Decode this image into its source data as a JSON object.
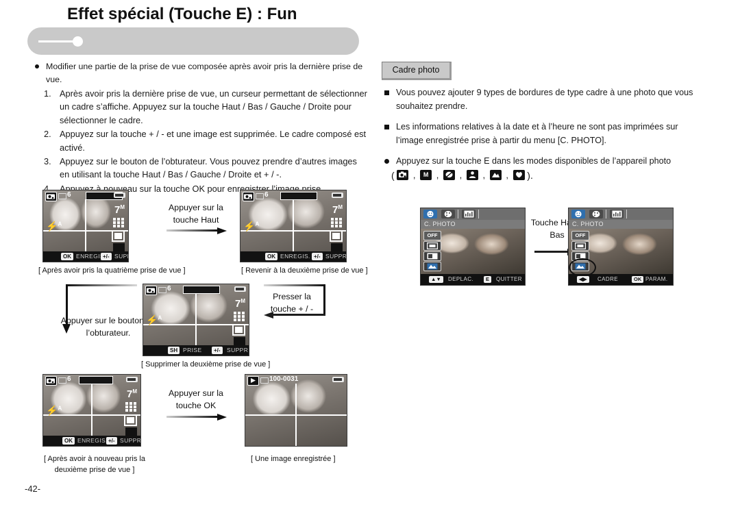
{
  "page": {
    "title": "Effet spécial (Touche E) : Fun",
    "page_number": "-42-"
  },
  "left_column": {
    "intro": "Modifier une partie de la prise de vue composée après avoir pris la dernière prise de vue.",
    "steps": [
      {
        "num": "1.",
        "text": "Après avoir pris la dernière prise de vue, un curseur permettant de sélectionner un cadre s’affiche. Appuyez sur la touche Haut / Bas / Gauche / Droite pour sélectionner le cadre."
      },
      {
        "num": "2.",
        "text": "Appuyez sur la touche + / - et une image est supprimée. Le cadre composé est activé."
      },
      {
        "num": "3.",
        "text": "Appuyez sur le bouton de l’obturateur. Vous pouvez prendre d’autres images en utilisant la touche Haut / Bas / Gauche / Droite et + / -."
      },
      {
        "num": "4.",
        "text": "Appuyez à nouveau sur la touche OK pour enregistrer l’image prise."
      }
    ]
  },
  "right_column": {
    "tab_label": "Cadre photo",
    "notes": [
      "Vous pouvez ajouter 9 types de bordures de type cadre à une photo que vous souhaitez prendre.",
      "Les informations relatives à la date et à l’heure ne sont pas imprimées sur l’image enregistrée prise à partir du menu [C. PHOTO]."
    ],
    "mode_note": "Appuyez sur la touche E dans les modes disponibles de l’appareil photo",
    "mode_icons": {
      "open_paren": "(",
      "close_paren": ").",
      "separator": ",",
      "items": [
        "program-mode-icon",
        "manual-mode-icon",
        "night-mode-icon",
        "portrait-mode-icon",
        "landscape-mode-icon",
        "macro-mode-icon"
      ],
      "manual_letter": "M"
    }
  },
  "flow": {
    "screens": [
      {
        "id": "screen-fourth-shot",
        "status": {
          "shots": "6",
          "resolution": "7",
          "res_unit": "M"
        },
        "bottom": {
          "key1": "OK",
          "label1": "ENREGIS.",
          "key2": "+/-",
          "label2": "SUPPRIMER"
        },
        "caption": "[ Après avoir pris la quatrième prise de vue ]"
      },
      {
        "id": "screen-second-shot-return",
        "status": {
          "shots": "6",
          "resolution": "7",
          "res_unit": "M"
        },
        "bottom": {
          "key1": "OK",
          "label1": "ENREGIS.",
          "key2": "+/-",
          "label2": "SUPPRIMER"
        },
        "caption": "[ Revenir à la deuxième prise de vue ]"
      },
      {
        "id": "screen-delete-second-shot",
        "status": {
          "shots": "6",
          "resolution": "7",
          "res_unit": "M"
        },
        "bottom": {
          "key1": "SH",
          "label1": "PRISE",
          "key2": "+/-",
          "label2": "SUPPRIMER"
        },
        "caption": "[ Supprimer la deuxième prise de vue ]"
      },
      {
        "id": "screen-retaken-second-shot",
        "status": {
          "shots": "6",
          "resolution": "7",
          "res_unit": "M"
        },
        "bottom": {
          "key1": "OK",
          "label1": "ENREGIS.",
          "key2": "+/-",
          "label2": "SUPPRIMER"
        },
        "caption": "[ Après avoir à nouveau pris la deuxième prise de vue ]"
      },
      {
        "id": "screen-saved-image",
        "status": {
          "frame_id": "100-0031"
        },
        "caption": "[ Une image enregistrée ]"
      }
    ],
    "labels": [
      {
        "id": "label-press-up",
        "text": "Appuyer sur la touche Haut"
      },
      {
        "id": "label-press-plus-minus",
        "text": "Presser la touche + / -"
      },
      {
        "id": "label-press-shutter",
        "text": "Appuyer sur le bouton de l’obturateur."
      },
      {
        "id": "label-press-ok",
        "text": "Appuyer sur la touche OK"
      },
      {
        "id": "label-press-up-down",
        "text": "Touche Haut / Bas"
      }
    ]
  },
  "menus": [
    {
      "id": "menu-c-photo-off",
      "title": "C. PHOTO",
      "items": [
        "OFF",
        "",
        "",
        ""
      ],
      "bottom": {
        "key1": "",
        "label1": "DEPLAC.",
        "key2": "E",
        "label2": "QUITTER"
      }
    },
    {
      "id": "menu-c-photo-frame",
      "title": "C. PHOTO",
      "items": [
        "OFF",
        "",
        "",
        ""
      ],
      "bottom": {
        "key1": "",
        "label1": "CADRE",
        "key2": "OK",
        "label2": "PARAM."
      }
    }
  ],
  "colors": {
    "banner": "#c9c9c9",
    "tab_bg": "#c9c9c9",
    "text": "#1a1a1a",
    "menu_tab_selected": "#2f6fae"
  }
}
